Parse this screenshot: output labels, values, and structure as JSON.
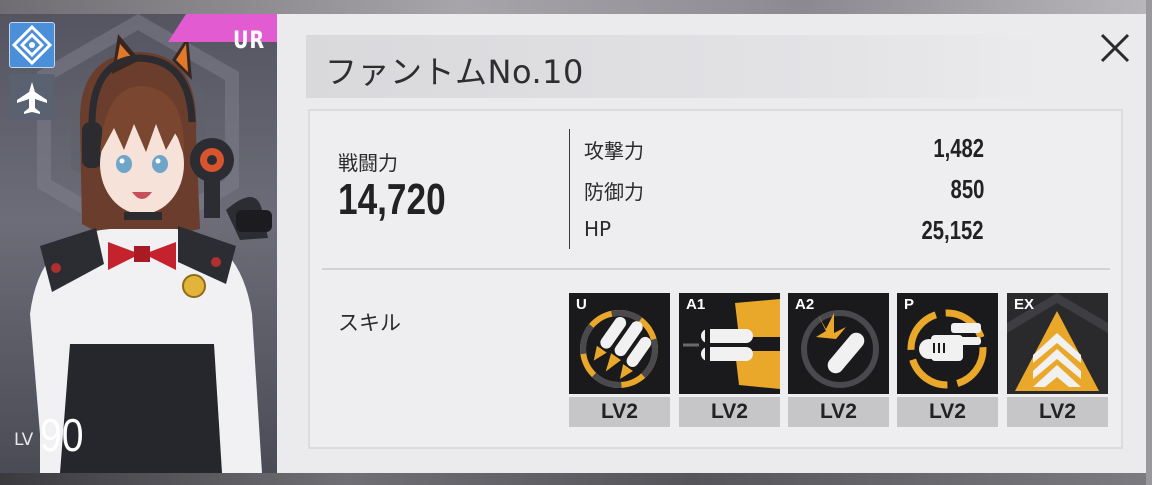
{
  "card": {
    "rarity": "UR",
    "level_label": "LV",
    "level_value": "90",
    "faction_icon": "faction-emblem-icon",
    "class_icon": "aircraft-icon"
  },
  "panel": {
    "name": "ファントムNo.10",
    "close_icon": "close-icon",
    "combat_power_label": "戦闘力",
    "combat_power_value": "14,720",
    "stats": [
      {
        "label": "攻撃力",
        "value": "1,482"
      },
      {
        "label": "防御力",
        "value": "850"
      },
      {
        "label": "HP",
        "value": "25,152"
      }
    ],
    "skills_label": "スキル",
    "skills": [
      {
        "tag": "U",
        "level": "LV2",
        "icon": "missile-barrage-icon"
      },
      {
        "tag": "A1",
        "level": "LV2",
        "icon": "twin-shells-icon"
      },
      {
        "tag": "A2",
        "level": "LV2",
        "icon": "shell-impact-icon"
      },
      {
        "tag": "P",
        "level": "LV2",
        "icon": "turret-target-icon"
      },
      {
        "tag": "EX",
        "level": "LV2",
        "icon": "rank-chevron-icon"
      }
    ]
  },
  "colors": {
    "accent_gold": "#e9a82a",
    "rarity_pink": "#e25bd0",
    "skill_bg": "#1a1a1c"
  }
}
